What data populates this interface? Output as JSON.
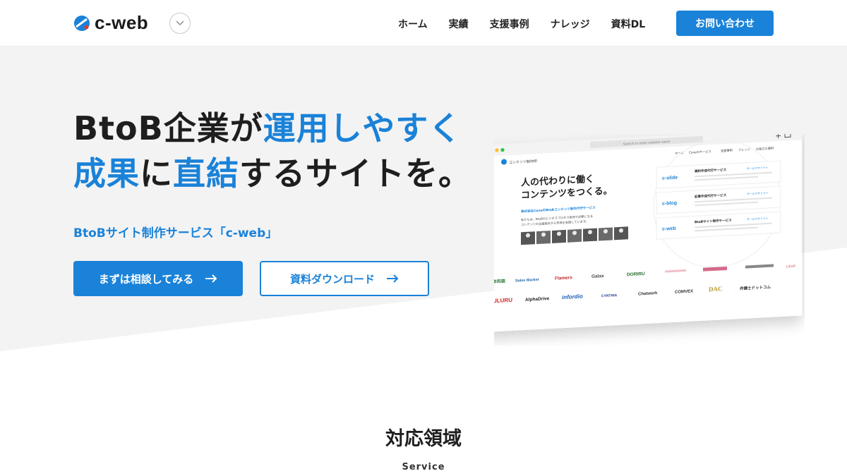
{
  "header": {
    "logo_text": "c-web",
    "nav": [
      "ホーム",
      "実績",
      "支援事例",
      "ナレッジ",
      "資料DL"
    ],
    "contact_label": "お問い合わせ"
  },
  "hero": {
    "line1_a": "BtoB企業が",
    "line1_b": "運用しやすく",
    "line2_a": "成果",
    "line2_b": "に",
    "line2_c": "直結",
    "line2_d": "するサイトを。",
    "sub": "BtoBサイト制作サービス「c-web」",
    "cta_primary": "まずは相談してみる",
    "cta_secondary": "資料ダウンロード"
  },
  "mock": {
    "url_placeholder": "Search or enter website name",
    "site_logo": "コンテンツ制作所",
    "nav": [
      "ホーム",
      "Coneのサービス",
      "支援事例",
      "ナレッジ",
      "お役立ち資料"
    ],
    "heading1": "人の代わりに働く",
    "heading2": "コンテンツをつくる。",
    "tagline": "株式会社ConeのBtoBコンテンツ制作代行サービス",
    "desc1": "私たちは、BtoBのビジネスプロセス各所で必要になる",
    "desc2": "コンテンツの企画設計から作成を支援しています。",
    "services": [
      {
        "brand": "c-slide",
        "title": "資料作成代行サービス",
        "link": "サービスサイトへ"
      },
      {
        "brand": "c-blog",
        "title": "記事作成代行サービス",
        "link": "サービスサイトへ"
      },
      {
        "brand": "c-web",
        "title": "BtoBサイト制作サービス",
        "link": "サービスサイトへ"
      }
    ],
    "clients_row1": [
      "本和装",
      "Sales Marker",
      "Flamers",
      "Galax",
      "DORIRU",
      "LEAP"
    ],
    "clients_row2": [
      "ULURU",
      "AlphaDrive",
      "infordio",
      "CYNTHIA",
      "Chatwork",
      "COMVEX",
      "DAC",
      "弁護士ドットコム"
    ]
  },
  "section": {
    "title": "対応領域",
    "subtitle": "Service"
  },
  "colors": {
    "accent": "#1a82d8",
    "hero_bg": "#f3f3f4"
  }
}
